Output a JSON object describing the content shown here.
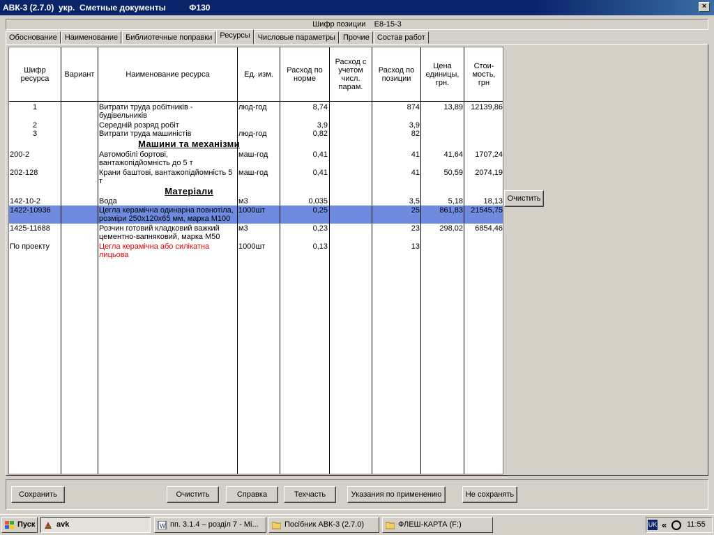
{
  "window": {
    "title": "АВК-3 (2.7.0)  укр.  Сметные документы          Ф130",
    "close": "×"
  },
  "position_code": {
    "label": "Шифр позиции",
    "value": "Е8-15-3"
  },
  "tabs": [
    {
      "label": "Обоснование"
    },
    {
      "label": "Наименование"
    },
    {
      "label": "Библиотечные поправки"
    },
    {
      "label": "Ресурсы",
      "active": true
    },
    {
      "label": "Числовые параметры"
    },
    {
      "label": "Прочие"
    },
    {
      "label": "Состав работ"
    }
  ],
  "columns": [
    "Шифр ресурса",
    "Вариант",
    "Наименование ресурса",
    "Ед. изм.",
    "Расход по норме",
    "Расход с учетом числ. парам.",
    "Расход по позиции",
    "Цена единицы, грн.",
    "Стои-мость, грн"
  ],
  "rows": [
    {
      "code": "1",
      "name": "Витрати труда робітників - будівельників",
      "unit": "люд-год",
      "norm": "8,74",
      "pos": "874",
      "price": "13,89",
      "cost": "12139,86"
    },
    {
      "code": "2",
      "name": "Середній розряд робіт",
      "unit": "",
      "norm": "3,9",
      "pos": "3,9",
      "price": "",
      "cost": ""
    },
    {
      "code": "3",
      "name": "Витрати труда машиністів",
      "unit": "люд-год",
      "norm": "0,82",
      "pos": "82",
      "price": "",
      "cost": ""
    },
    {
      "code": "200-2",
      "name": "Автомобілі бортові, вантажопідйомність до 5 т",
      "unit": "маш-год",
      "norm": "0,41",
      "pos": "41",
      "price": "41,64",
      "cost": "1707,24"
    },
    {
      "code": "202-128",
      "name": "Крани баштові, вантажопідйомність 5 т",
      "unit": "маш-год",
      "norm": "0,41",
      "pos": "41",
      "price": "50,59",
      "cost": "2074,19"
    },
    {
      "code": "142-10-2",
      "name": "Вода",
      "unit": "м3",
      "norm": "0,035",
      "pos": "3,5",
      "price": "5,18",
      "cost": "18,13"
    },
    {
      "code": "1422-10936",
      "name": "Цегла керамічна одинарна повнотіла, розміри 250х120х65 мм, марка М100",
      "unit": "1000шт",
      "norm": "0,25",
      "pos": "25",
      "price": "861,83",
      "cost": "21545,75"
    },
    {
      "code": "1425-11688",
      "name": "Розчин готовий кладковий важкий цементно-вапняковий, марка М50",
      "unit": "м3",
      "norm": "0,23",
      "pos": "23",
      "price": "298,02",
      "cost": "6854,46"
    },
    {
      "code": "По проекту",
      "name": "Цегла керамічна або силікатна лицьова",
      "unit": "1000шт",
      "norm": "0,13",
      "pos": "13",
      "price": "",
      "cost": ""
    }
  ],
  "sections": {
    "machines": "Машини та механізми",
    "materials": "Матеріали"
  },
  "side_button": "Очистить",
  "buttons": {
    "save": "Сохранить",
    "clear": "Очистить",
    "help": "Справка",
    "techpart": "Техчасть",
    "instructions": "Указания по применению",
    "nosave": "Не сохранять"
  },
  "taskbar": {
    "start": "Пуск",
    "items": [
      "avk",
      "пп. 3.1.4 – розділ 7 - Мі...",
      "Посібник АВК-3 (2.7.0)",
      "ФЛЕШ-КАРТА (F:)"
    ],
    "lang": "UK",
    "chevron": "«",
    "time": "11:55"
  },
  "colors": {
    "title_bar": "#0a246a",
    "selection": "#6f8be0",
    "red_text": "#e00000",
    "face": "#d4d0c8"
  }
}
